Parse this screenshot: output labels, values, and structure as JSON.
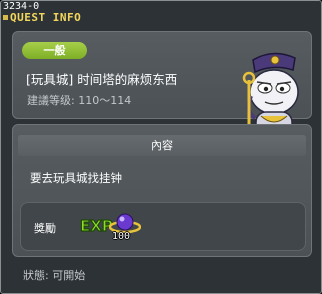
{
  "window": {
    "id_code": "3234-0",
    "title": "QUEST INFO"
  },
  "quest": {
    "category_badge": "一般",
    "name": "[玩具城] 时间塔的麻烦东西",
    "level_requirement": "建議等级: 110～114"
  },
  "content": {
    "header": "內容",
    "description": "要去玩具城找挂钟"
  },
  "reward": {
    "label": "獎勵",
    "items": [
      {
        "icon": "exp-icon",
        "text": "EXP"
      },
      {
        "icon": "purple-orb-icon",
        "count": "100"
      }
    ]
  },
  "status": "狀態: 可開始",
  "colors": {
    "title": "#f3d75c",
    "badge": "#8bbd2f",
    "window_bg": "#2d3236",
    "panel_bg": "#51575b"
  }
}
